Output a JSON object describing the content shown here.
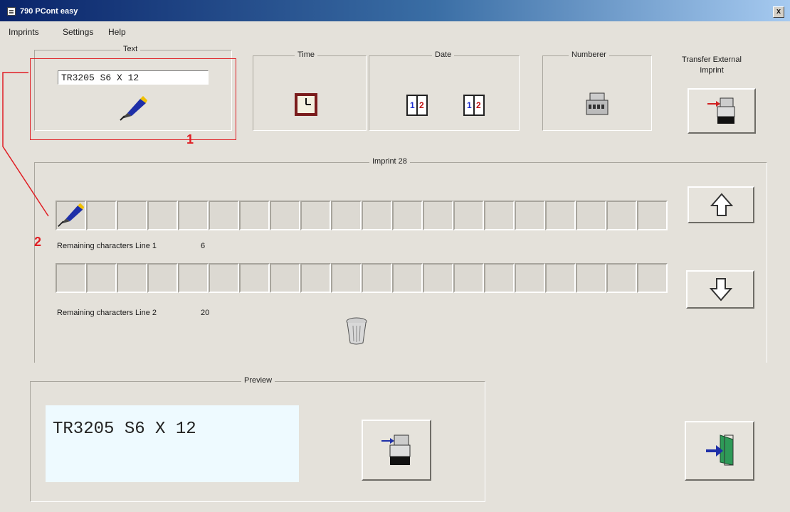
{
  "window": {
    "title": "790 PCont easy",
    "close_label": "x"
  },
  "menu": {
    "items": [
      "Imprints",
      "Settings",
      "Help"
    ]
  },
  "groups": {
    "text": {
      "title": "Text",
      "value": "TR3205 S6 X 12"
    },
    "time": {
      "title": "Time"
    },
    "date": {
      "title": "Date"
    },
    "numberer": {
      "title": "Numberer"
    },
    "transfer": {
      "title": "Transfer External Imprint",
      "title_line1": "Transfer External",
      "title_line2": "Imprint"
    }
  },
  "imprint": {
    "title": "Imprint 28",
    "line1_label": "Remaining characters Line 1",
    "line1_count": "6",
    "line2_label": "Remaining characters Line 2",
    "line2_count": "20"
  },
  "preview": {
    "title": "Preview",
    "text": "TR3205 S6 X 12"
  },
  "annotations": {
    "label_1": "1",
    "label_2": "2"
  },
  "colors": {
    "annotation": "#e01e24",
    "preview_bg": "#eefaff",
    "titlebar": "#0a246a"
  },
  "icons": [
    "pen-icon",
    "clock-icon",
    "calendar-icon",
    "numberer-icon",
    "transfer-printer-icon",
    "arrow-up-icon",
    "arrow-down-icon",
    "trash-icon",
    "printer-icon",
    "exit-icon"
  ]
}
